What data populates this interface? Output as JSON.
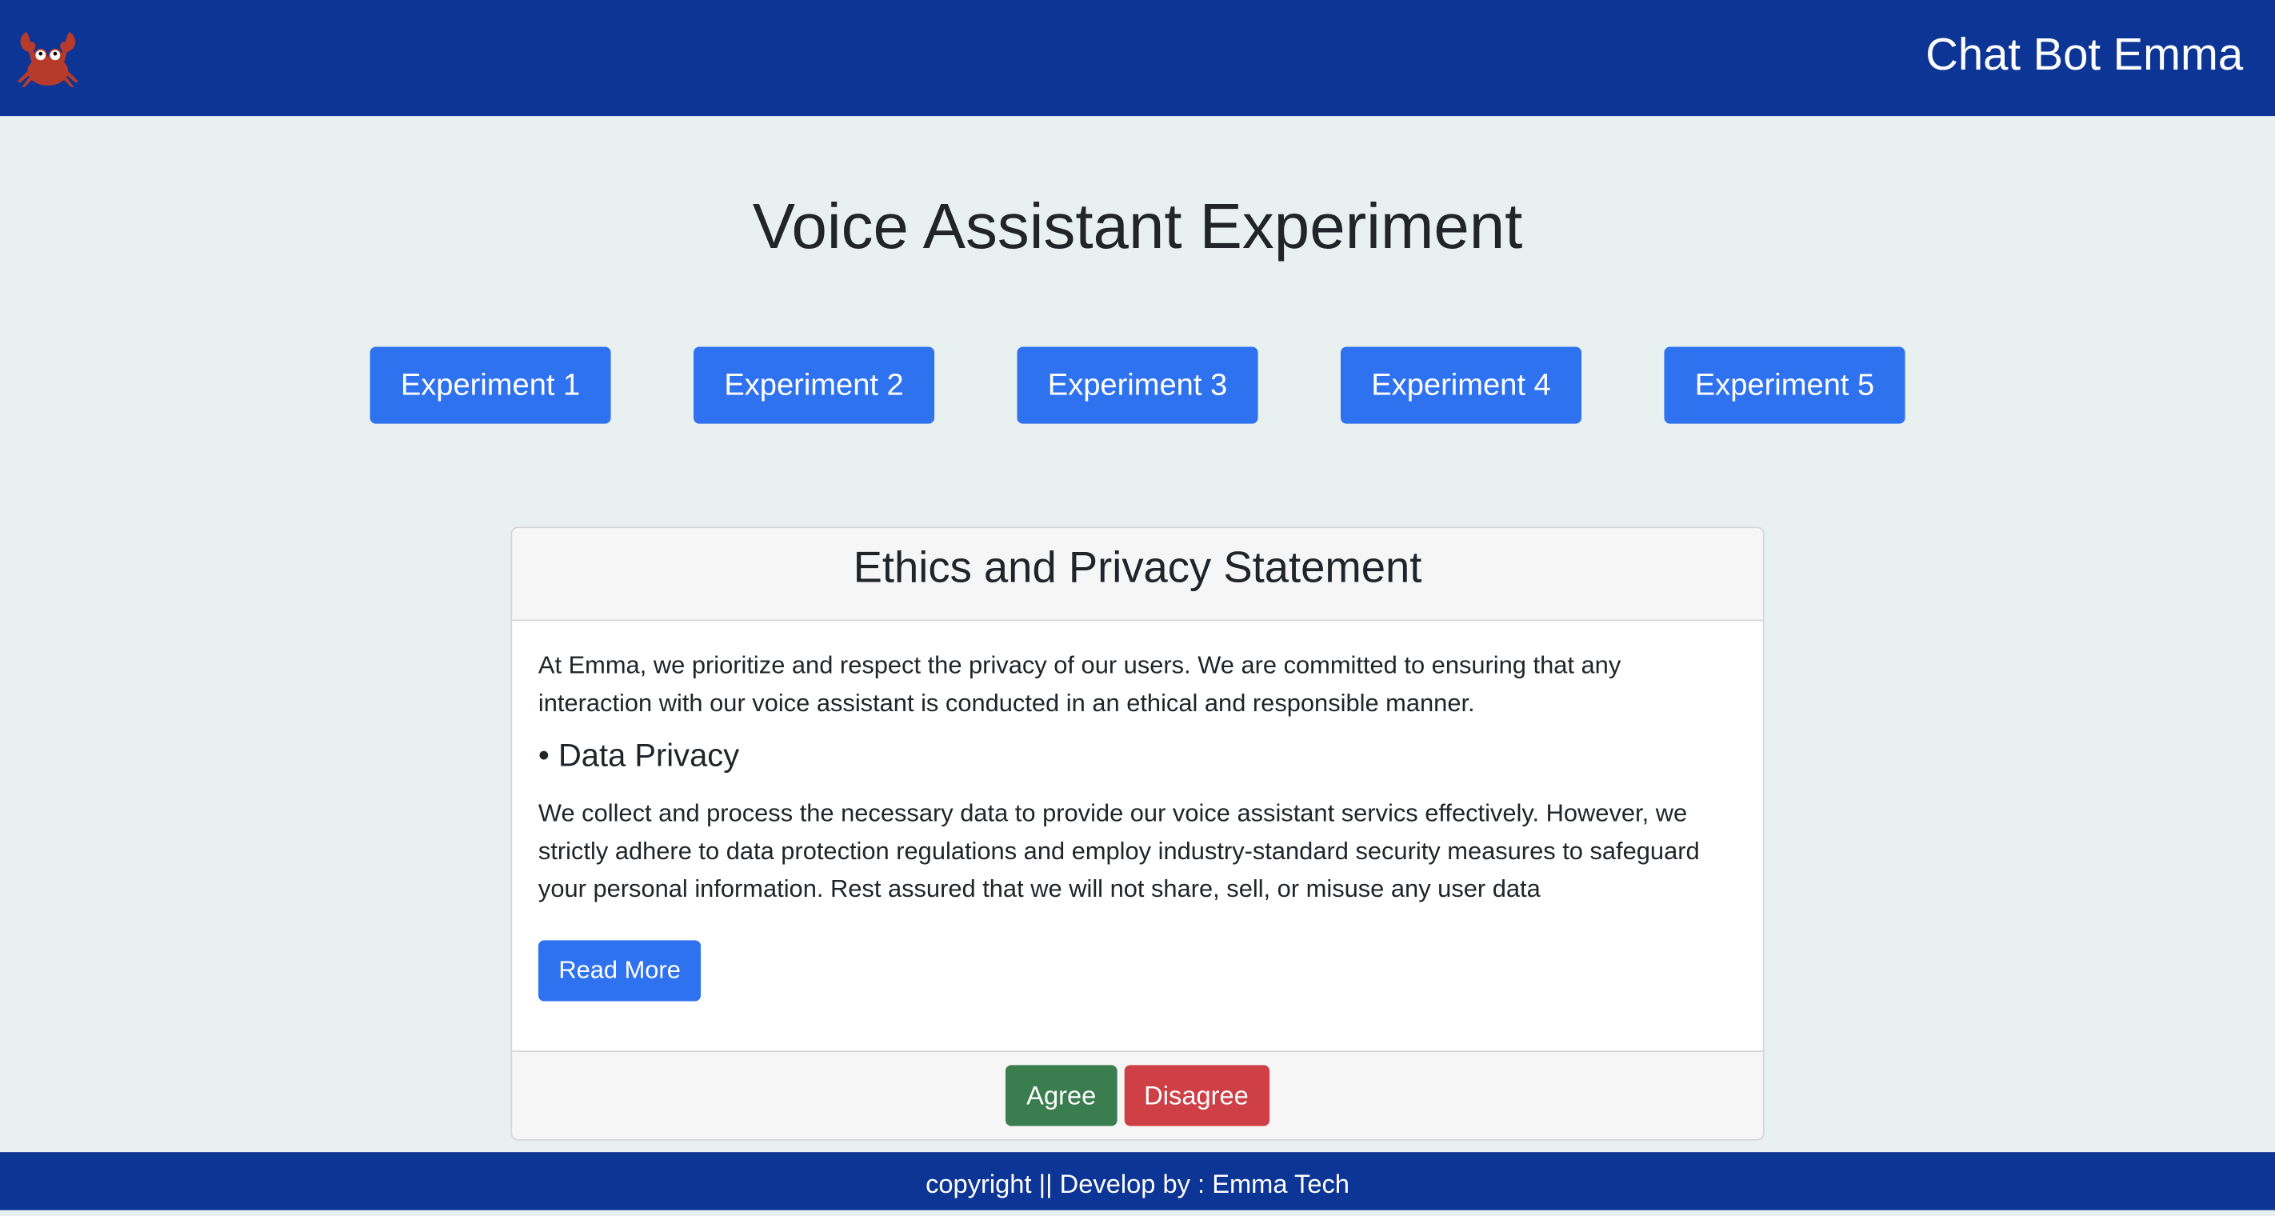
{
  "header": {
    "brand": "Chat Bot Emma",
    "logo_icon": "crab-icon"
  },
  "page_title": "Voice Assistant Experiment",
  "experiments": [
    "Experiment 1",
    "Experiment 2",
    "Experiment 3",
    "Experiment 4",
    "Experiment 5"
  ],
  "card": {
    "title": "Ethics and Privacy Statement",
    "intro": "At Emma, we prioritize and respect the privacy of our users. We are committed to ensuring that any interaction with our voice assistant is conducted in an ethical and responsible manner.",
    "section_title": "• Data Privacy",
    "section_text": "We collect and process the necessary data to provide our voice assistant servics effectively. However, we strictly adhere to data protection regulations and employ industry-standard security measures to safeguard your personal information. Rest assured that we will not share, sell, or misuse any user data",
    "read_more": "Read More",
    "agree": "Agree",
    "disagree": "Disagree"
  },
  "footer": "copyright || Develop by : Emma Tech",
  "colors": {
    "nav": "#0d3595",
    "primary": "#2f72f0",
    "success": "#3a7d4f",
    "danger": "#cf3f46"
  }
}
